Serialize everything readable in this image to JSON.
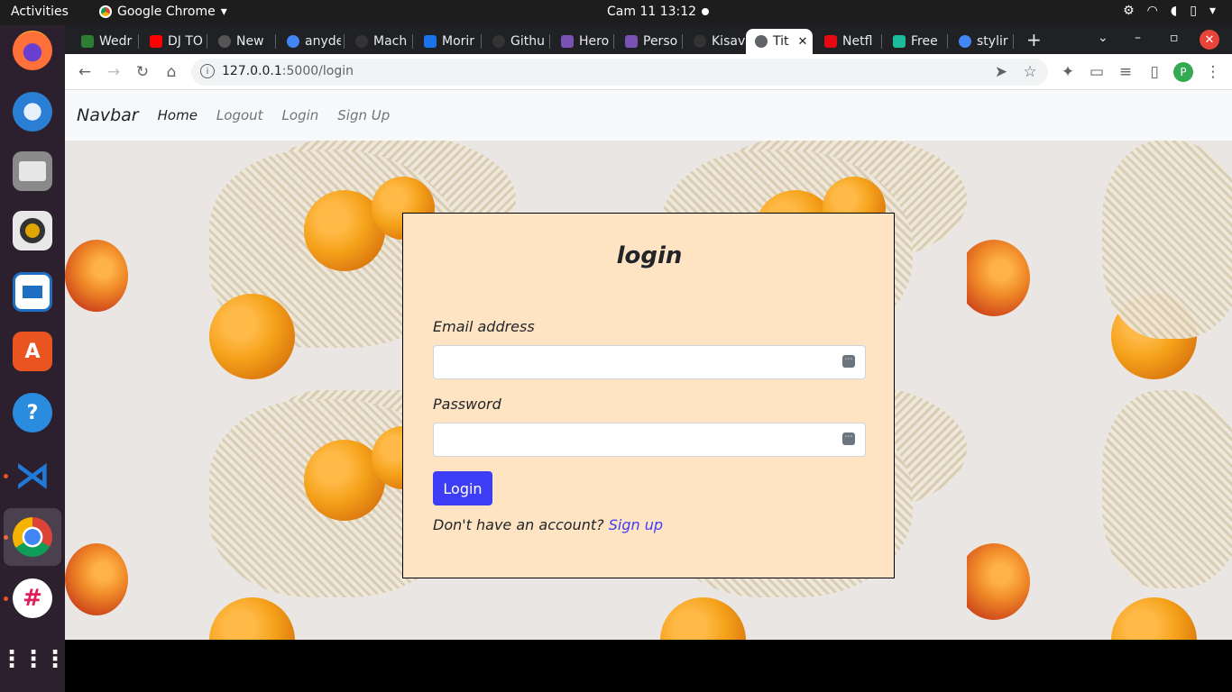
{
  "topbar": {
    "activities": "Activities",
    "app_name": "Google Chrome",
    "app_arrow": "▾",
    "clock": "Cam 11  13:12",
    "tray_icons": [
      "network-icon",
      "wifi-icon",
      "volume-icon",
      "battery-icon",
      "power-menu-icon"
    ],
    "tray_arrow": "▾"
  },
  "dock": {
    "items": [
      {
        "name": "firefox",
        "color": "#ff7139"
      },
      {
        "name": "thunderbird",
        "color": "#2a7fd4"
      },
      {
        "name": "files",
        "color": "#8a8a8a"
      },
      {
        "name": "rhythmbox",
        "color": "#e0a500"
      },
      {
        "name": "libreoffice-writer",
        "color": "#1e6fc2"
      },
      {
        "name": "ubuntu-software",
        "color": "#e95420"
      },
      {
        "name": "help",
        "color": "#2a8cde"
      },
      {
        "name": "vscode",
        "color": "#1f7ad8"
      },
      {
        "name": "chrome",
        "color": "#4285f4"
      },
      {
        "name": "slack",
        "color": "#ffffff"
      },
      {
        "name": "show-apps",
        "color": "#ffffff"
      }
    ]
  },
  "tabs": [
    {
      "label": "Wedr",
      "favicon": "#2e7d32"
    },
    {
      "label": "DJ TO",
      "favicon": "#ff0000"
    },
    {
      "label": "New",
      "favicon": "#555555"
    },
    {
      "label": "anyde",
      "favicon": "#4285f4"
    },
    {
      "label": "Mach",
      "favicon": "#333333"
    },
    {
      "label": "Morir",
      "favicon": "#1a73e8"
    },
    {
      "label": "Githu",
      "favicon": "#333333"
    },
    {
      "label": "Hero",
      "favicon": "#7952b3"
    },
    {
      "label": "Perso",
      "favicon": "#7952b3"
    },
    {
      "label": "Kisav",
      "favicon": "#333333"
    },
    {
      "label": "Tit",
      "favicon": "#5f6368"
    },
    {
      "label": "Netfl",
      "favicon": "#e50914"
    },
    {
      "label": "Free",
      "favicon": "#1abc9c"
    },
    {
      "label": "stylir",
      "favicon": "#4285f4"
    }
  ],
  "tab_close": "✕",
  "new_tab": "+",
  "window_controls": {
    "list": "⌄",
    "minimize": "–",
    "maximize": "▫",
    "close": "✕"
  },
  "toolbar": {
    "back": "←",
    "forward": "→",
    "reload": "↻",
    "home": "⌂",
    "url_host": "127.0.0.1",
    "url_path": ":5000/login",
    "send": "➤",
    "star": "☆",
    "extensions": "✦",
    "cast": "▭",
    "media": "≡",
    "sidepanel": "▯",
    "profile_initial": "P",
    "menu": "⋮"
  },
  "navbar": {
    "brand": "Navbar",
    "links": [
      "Home",
      "Logout",
      "Login",
      "Sign Up"
    ]
  },
  "login": {
    "title": "login",
    "email_label": "Email address",
    "email_value": "",
    "password_label": "Password",
    "password_value": "",
    "input_icon": "⋯",
    "submit": "Login",
    "signup_prompt": "Don't have an account?",
    "signup_link": "Sign up"
  }
}
